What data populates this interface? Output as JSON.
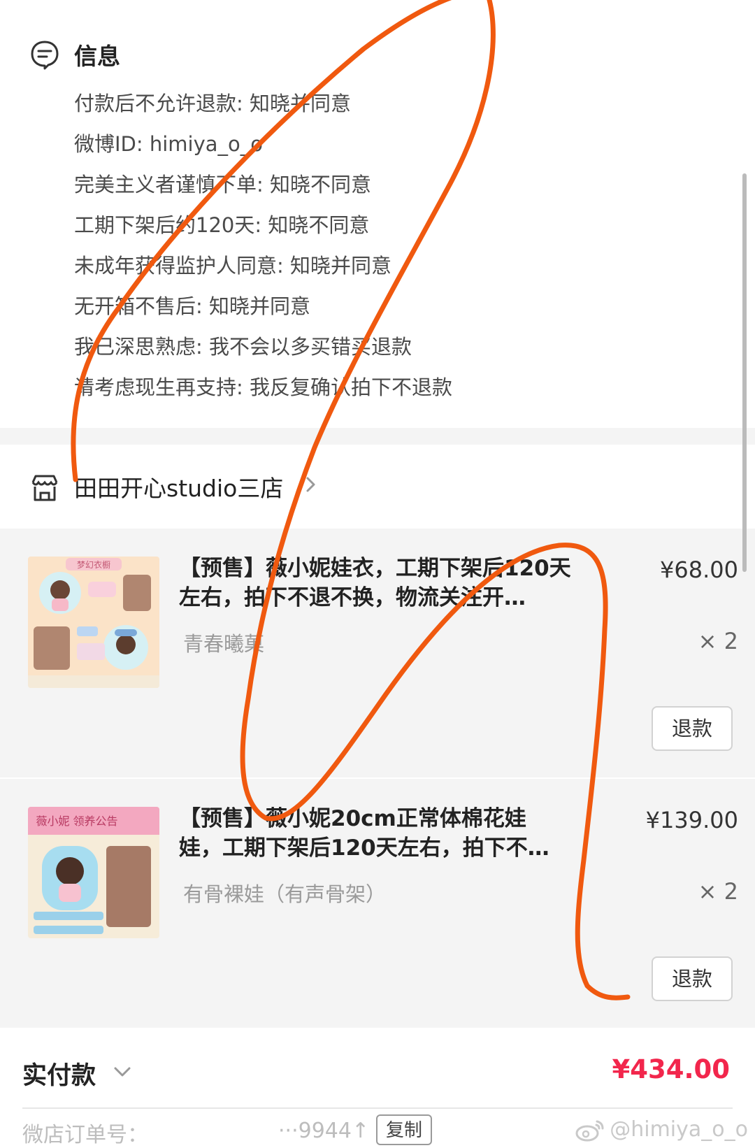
{
  "info": {
    "title": "信息",
    "icon": "chat-bubble-icon",
    "lines": [
      "付款后不允许退款: 知晓并同意",
      "微博ID: himiya_o_o",
      "完美主义者谨慎下单: 知晓不同意",
      "工期下架后约120天: 知晓不同意",
      "未成年获得监护人同意: 知晓并同意",
      "无开箱不售后: 知晓并同意",
      "我已深思熟虑: 我不会以多买错买退款",
      "请考虑现生再支持: 我反复确认拍下不退款"
    ]
  },
  "shop": {
    "name": "田田开心studio三店",
    "icon": "storefront-icon",
    "arrow_icon": "chevron-right-icon"
  },
  "products": [
    {
      "title_line1": "【预售】薇小妮娃衣，工期下架后120天",
      "title_line2": "左右，拍下不退不换，物流关注开…",
      "variant": "青春曦菓",
      "price": "¥68.00",
      "quantity": "× 2",
      "refund_label": "退款",
      "thumb_banner": "梦幻衣橱"
    },
    {
      "title_line1": "【预售】薇小妮20cm正常体棉花娃",
      "title_line2": "娃，工期下架后120天左右，拍下不…",
      "variant": "有骨裸娃（有声骨架）",
      "price": "¥139.00",
      "quantity": "× 2",
      "refund_label": "退款",
      "thumb_banner": "薇小妮 领养公告"
    }
  ],
  "total": {
    "label": "实付款",
    "amount": "¥434.00"
  },
  "order": {
    "label": "微店订单号：",
    "number_fragment": "···9944↑",
    "copy_label": "复制"
  },
  "watermark": "@himiya_o_o",
  "colors": {
    "accent_price": "#f2264c",
    "card_background": "#f4f4f4",
    "scribble": "#f0590f"
  }
}
